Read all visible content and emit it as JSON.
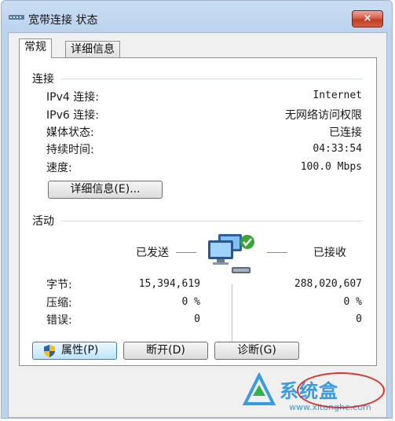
{
  "window": {
    "title": "宽带连接 状态",
    "close_label": "×"
  },
  "tabs": [
    {
      "label": "常规"
    },
    {
      "label": "详细信息"
    }
  ],
  "connection": {
    "group_label": "连接",
    "rows": [
      {
        "label": "IPv4 连接:",
        "value": "Internet"
      },
      {
        "label": "IPv6 连接:",
        "value": "无网络访问权限"
      },
      {
        "label": "媒体状态:",
        "value": "已连接"
      },
      {
        "label": "持续时间:",
        "value": "04:33:54"
      },
      {
        "label": "速度:",
        "value": "100.0 Mbps"
      }
    ],
    "details_button": "详细信息(E)..."
  },
  "activity": {
    "group_label": "活动",
    "sent_label": "已发送",
    "received_label": "已接收",
    "rows": [
      {
        "label": "字节:",
        "sent": "15,394,619",
        "received": "288,020,607"
      },
      {
        "label": "压缩:",
        "sent": "0 %",
        "received": "0 %"
      },
      {
        "label": "错误:",
        "sent": "0",
        "received": "0"
      }
    ]
  },
  "buttons": {
    "properties": "属性(P)",
    "disconnect": "断开(D)",
    "diagnose": "诊断(G)"
  },
  "watermark": {
    "brand": "系统盒",
    "url": "www.xitonghe.com"
  },
  "colors": {
    "accent": "#3c7fb1",
    "close": "#c23c25",
    "watermark": "#3a9be0"
  }
}
